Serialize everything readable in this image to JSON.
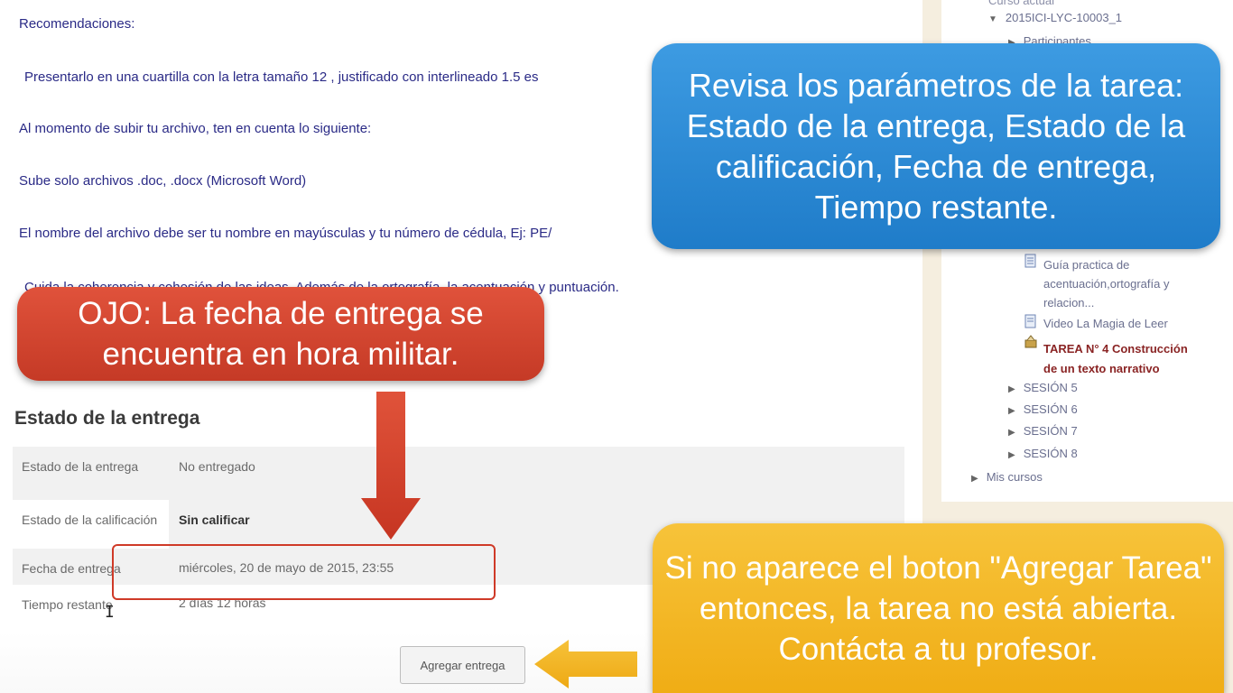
{
  "recommendations": {
    "heading": "Recomendaciones:",
    "lines": [
      "Presentarlo en una  cuartilla  con la letra tamaño 12 , justificado con interlineado 1.5  es",
      "Al momento de subir tu archivo, ten en cuenta lo siguiente:",
      "Sube solo archivos .doc, .docx (Microsoft Word)",
      "El nombre del archivo debe ser tu nombre en mayúsculas y tu número de cédula, Ej: PE/",
      "Cuida la coherencia y cohesión de las ideas.  Además  de la  ortografía,  la acentuación y  puntuación."
    ]
  },
  "submission_status": {
    "title": "Estado de la entrega",
    "rows": [
      {
        "label": "Estado de la entrega",
        "value": "No entregado"
      },
      {
        "label": "Estado de la calificación",
        "value": "Sin calificar"
      },
      {
        "label": "Fecha de entrega",
        "value": "miércoles, 20 de mayo de 2015, 23:55"
      },
      {
        "label": "Tiempo restante",
        "value": "2 días 12 horas"
      }
    ],
    "button_label": "Agregar entrega"
  },
  "sidebar": {
    "top_partial": "Curso actual",
    "course": "2015ICI-LYC-10003_1",
    "participants": "Participantes",
    "resources": [
      {
        "label_line1": "Guía practica de",
        "label_line2": "acentuación,ortografía y",
        "label_line3": "relacion...",
        "icon": "document-icon"
      },
      {
        "label_line1": "Video La Magia de Leer",
        "icon": "document-icon"
      },
      {
        "label_line1": "TAREA N° 4 Construcción",
        "label_line2": "de un texto narrativo",
        "icon": "assignment-icon"
      }
    ],
    "sessions": [
      "SESIÓN 5",
      "SESIÓN 6",
      "SESIÓN 7",
      "SESIÓN 8"
    ],
    "my_courses": "Mis cursos"
  },
  "callouts": {
    "blue": "Revisa los parámetros de la tarea: Estado de la entrega, Estado de la calificación, Fecha de entrega, Tiempo restante.",
    "red": "OJO: La fecha de entrega se encuentra en hora militar.",
    "yellow": "Si no aparece el boton \"Agregar Tarea\" entonces, la tarea no está abierta. Contácta a tu profesor."
  },
  "colors": {
    "callout_blue": "#2a8ad6",
    "callout_red": "#d2442f",
    "callout_yellow": "#f4b624",
    "arrow_red": "#d03a26",
    "arrow_yellow": "#f2b21c",
    "body_text": "#2a2a86"
  }
}
